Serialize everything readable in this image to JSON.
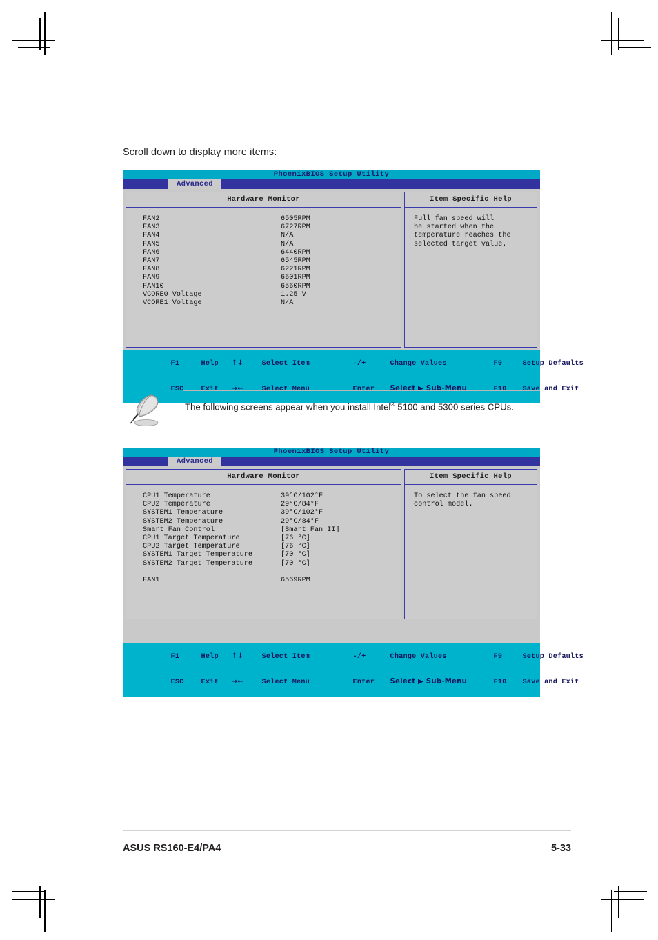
{
  "page": {
    "heading": "Scroll down to display more items:",
    "footer_left": "ASUS RS160-E4/PA4",
    "footer_right": "5-33"
  },
  "note": {
    "icon": "quill-pen-icon",
    "text_before_sup": "The following screens appear when you install Intel",
    "sup": "®",
    "text_after_sup": " 5100 and 5300 series CPUs."
  },
  "colors": {
    "title_bar": "#00aac6",
    "tab_bar": "#3333a0",
    "panel_bg": "#cccccc",
    "panel_border": "#3b3bb0",
    "footer_bar": "#00b3cc",
    "bios_text": "#16165f"
  },
  "bios_screens": [
    {
      "title": "PhoenixBIOS Setup Utility",
      "active_tab": "Advanced",
      "left_panel_title": "Hardware Monitor",
      "right_panel_title": "Item Specific Help",
      "help_text": "Full fan speed will\nbe started when the\ntemperature reaches the\nselected target value.",
      "rows": [
        {
          "label": "FAN2",
          "value": "6505RPM"
        },
        {
          "label": "FAN3",
          "value": "6727RPM"
        },
        {
          "label": "FAN4",
          "value": "N/A"
        },
        {
          "label": "FAN5",
          "value": "N/A"
        },
        {
          "label": "FAN6",
          "value": "6440RPM"
        },
        {
          "label": "FAN7",
          "value": "6545RPM"
        },
        {
          "label": "FAN8",
          "value": "6221RPM"
        },
        {
          "label": "FAN9",
          "value": "6601RPM"
        },
        {
          "label": "FAN10",
          "value": "6560RPM"
        },
        {
          "label": "VCORE0 Voltage",
          "value": "1.25 V"
        },
        {
          "label": "VCORE1 Voltage",
          "value": "N/A"
        }
      ]
    },
    {
      "title": "PhoenixBIOS Setup Utility",
      "active_tab": "Advanced",
      "left_panel_title": "Hardware Monitor",
      "right_panel_title": "Item Specific Help",
      "help_text": "To select the fan speed\ncontrol model.",
      "rows": [
        {
          "label": "CPU1 Temperature",
          "value": "39°C/102°F"
        },
        {
          "label": "CPU2 Temperature",
          "value": "29°C/84°F"
        },
        {
          "label": "SYSTEM1 Temperature",
          "value": "39°C/102°F"
        },
        {
          "label": "SYSTEM2 Temperature",
          "value": "29°C/84°F"
        },
        {
          "label": "Smart Fan Control",
          "value": "[Smart Fan II]"
        },
        {
          "label": "CPU1 Target Temperature",
          "value": "[76 °C]"
        },
        {
          "label": "CPU2 Target Temperature",
          "value": "[76 °C]"
        },
        {
          "label": "SYSTEM1 Target Temperature",
          "value": "[70 °C]"
        },
        {
          "label": "SYSTEM2 Target Temperature",
          "value": "[70 °C]"
        },
        {
          "label": "",
          "value": ""
        },
        {
          "label": "FAN1",
          "value": "6569RPM"
        }
      ]
    }
  ],
  "bios_footer": {
    "line1": [
      {
        "key": "F1",
        "action": "Help"
      },
      {
        "key": "↑↓",
        "action": "Select Item"
      },
      {
        "key": "-/+",
        "action": "Change Values"
      },
      {
        "key": "F9",
        "action": "Setup Defaults"
      }
    ],
    "line2": [
      {
        "key": "ESC",
        "action": "Exit"
      },
      {
        "key": "→←",
        "action": "Select Menu"
      },
      {
        "key": "Enter",
        "action": "Select ▶ Sub-Menu"
      },
      {
        "key": "F10",
        "action": "Save and Exit"
      }
    ]
  }
}
